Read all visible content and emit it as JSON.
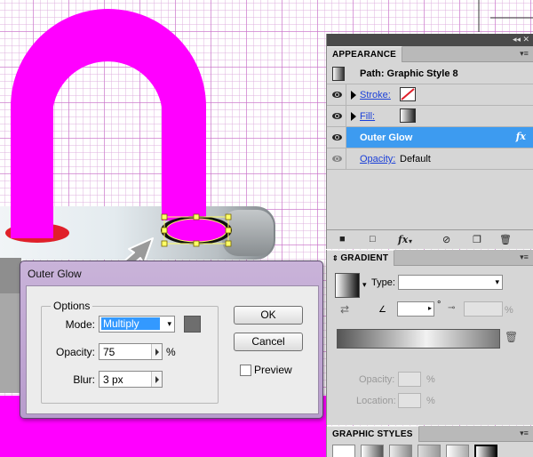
{
  "colors": {
    "shape_magenta": "#ff00ff",
    "selection_yellow": "#ffff66",
    "selected_row_blue": "#3d9bf0",
    "dialog_title_purple": "#c0a8d4",
    "link_blue": "#1a3fd8"
  },
  "appearance_panel": {
    "tab_label": "APPEARANCE",
    "menu_icon": "panel-menu-icon",
    "target": "Path: Graphic Style 8",
    "rows": [
      {
        "label": "Stroke:",
        "swatch": "none",
        "visible": true
      },
      {
        "label": "Fill:",
        "swatch": "gradient",
        "visible": true
      },
      {
        "label": "Outer Glow",
        "fx": "fx",
        "visible": true,
        "selected": true
      },
      {
        "label": "Opacity:",
        "value": "Default",
        "visible": true
      }
    ],
    "footer_icons": [
      "new-stroke-icon",
      "new-fill-icon",
      "fx-icon",
      "clear-icon",
      "duplicate-icon",
      "delete-icon"
    ],
    "footer_fx_label": "fx"
  },
  "gradient_panel": {
    "tab_label": "GRADIENT",
    "type_label": "Type:",
    "type_value": "",
    "angle_value": "",
    "angle_unit": "°",
    "aspect_value": "",
    "aspect_unit": "%",
    "opacity_label": "Opacity:",
    "opacity_unit": "%",
    "location_label": "Location:",
    "location_unit": "%"
  },
  "graphic_styles_panel": {
    "tab_label": "GRAPHIC STYLES"
  },
  "outer_glow_dialog": {
    "title": "Outer Glow",
    "options_legend": "Options",
    "mode_label": "Mode:",
    "mode_value": "Multiply",
    "opacity_label": "Opacity:",
    "opacity_value": "75",
    "opacity_unit": "%",
    "blur_label": "Blur:",
    "blur_value": "3 px",
    "ok_label": "OK",
    "cancel_label": "Cancel",
    "preview_label": "Preview",
    "preview_checked": false,
    "glow_color": "#6e6e6e"
  }
}
